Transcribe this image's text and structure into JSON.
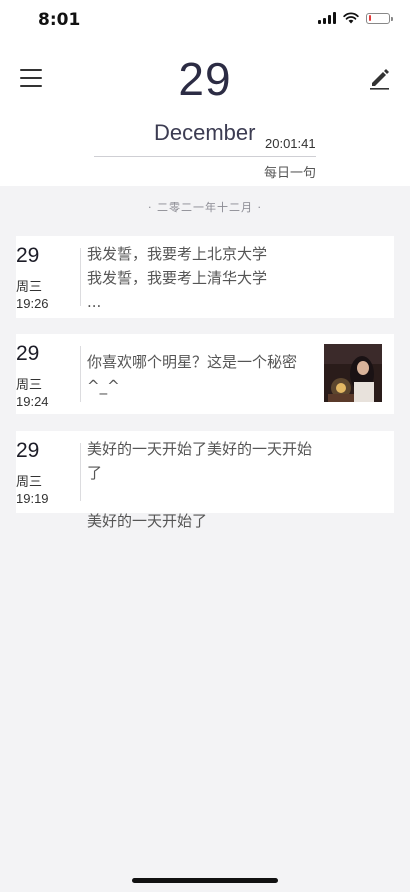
{
  "status_bar": {
    "time": "8:01",
    "battery_level": 0.15,
    "battery_color": "#e43b3b"
  },
  "header": {
    "menu_icon": "menu-icon",
    "edit_icon": "edit-icon",
    "day": "29",
    "month": "December",
    "time": "20:01:41",
    "quote_link": "每日一句"
  },
  "section": {
    "month_label": "· 二零二一年十二月 ·"
  },
  "entries": [
    {
      "day": "29",
      "weekday": "周三",
      "time": "19:26",
      "text": "我发誓，我要考上北京大学\n我发誓，我要考上清华大学\n..."
    },
    {
      "day": "29",
      "weekday": "周三",
      "time": "19:24",
      "text": "你喜欢哪个明星？这是一个秘密\n^_^",
      "has_image": true
    },
    {
      "day": "29",
      "weekday": "周三",
      "time": "19:19",
      "text": "美好的一天开始了美好的一天开始了\n\n美好的一天开始了"
    }
  ]
}
